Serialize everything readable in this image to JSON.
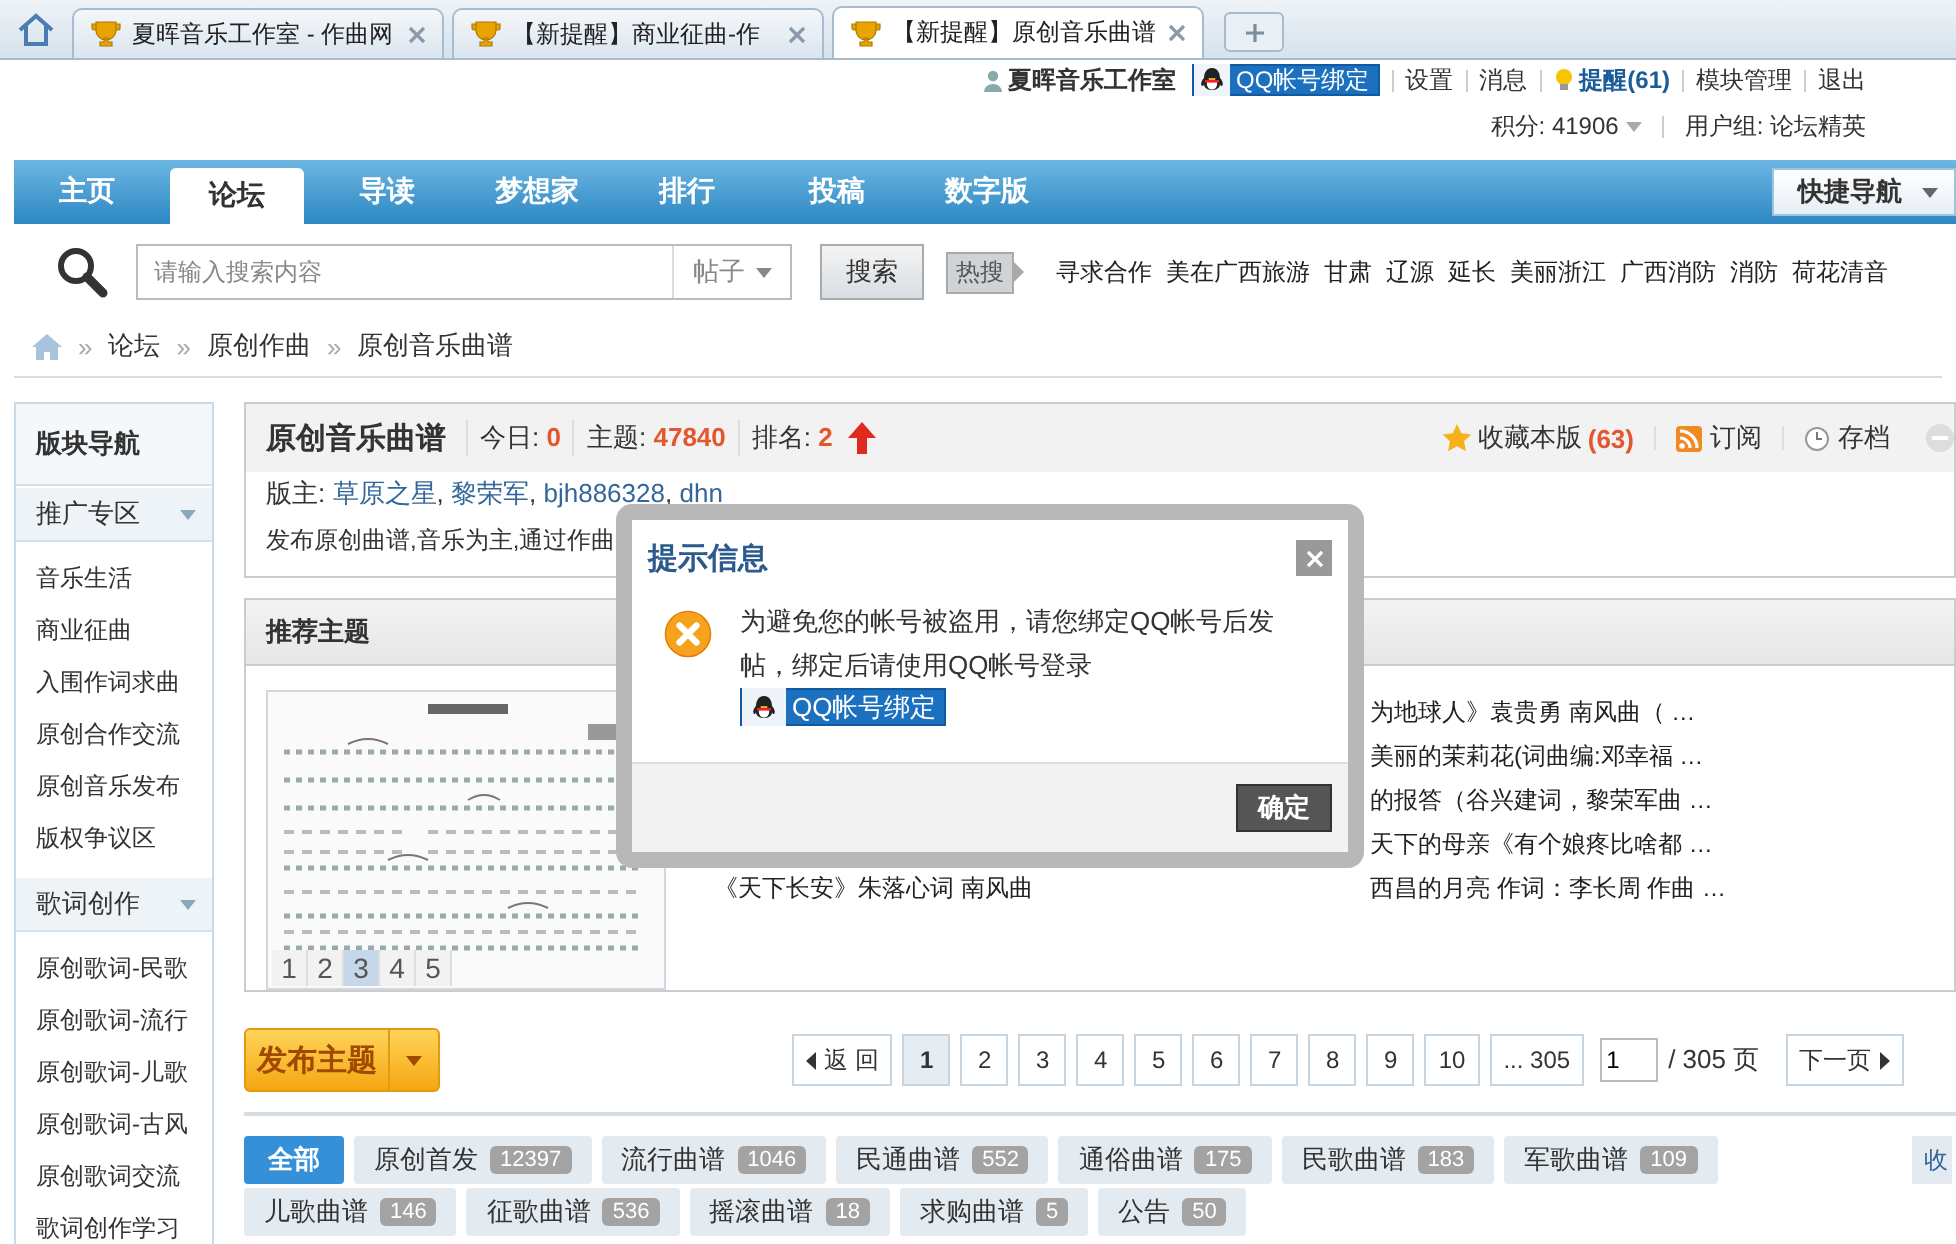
{
  "browser_tabs": [
    {
      "title": "夏晖音乐工作室 - 作曲网",
      "selected": false
    },
    {
      "title": "【新提醒】商业征曲-作",
      "selected": false
    },
    {
      "title": "【新提醒】原创音乐曲谱",
      "selected": true
    }
  ],
  "user_bar": {
    "username": "夏晖音乐工作室",
    "qq_bind": "QQ帐号绑定",
    "links": [
      {
        "label": "设置",
        "kind": "plain"
      },
      {
        "label": "消息",
        "kind": "plain"
      },
      {
        "label": "提醒(61)",
        "kind": "alert"
      },
      {
        "label": "模块管理",
        "kind": "plain"
      },
      {
        "label": "退出",
        "kind": "plain"
      }
    ],
    "credits": "积分: 41906",
    "usergroup": "用户组: 论坛精英"
  },
  "nav": {
    "items": [
      {
        "label": "主页",
        "selected": false
      },
      {
        "label": "论坛",
        "selected": true
      },
      {
        "label": "导读",
        "selected": false
      },
      {
        "label": "梦想家",
        "selected": false
      },
      {
        "label": "排行",
        "selected": false
      },
      {
        "label": "投稿",
        "selected": false
      },
      {
        "label": "数字版",
        "selected": false
      }
    ],
    "quick_nav": "快捷导航"
  },
  "search": {
    "placeholder": "请输入搜索内容",
    "scope": "帖子",
    "button": "搜索",
    "hot_label": "热搜",
    "hot_words": [
      "寻求合作",
      "美在广西旅游",
      "甘肃",
      "辽源",
      "延长",
      "美丽浙江",
      "广西消防",
      "消防",
      "荷花清音"
    ]
  },
  "breadcrumb": [
    {
      "sep": "»",
      "label": "论坛"
    },
    {
      "sep": "»",
      "label": "原创作曲"
    },
    {
      "sep": "»",
      "label": "原创音乐曲谱"
    }
  ],
  "sidebar": {
    "title": "版块导航",
    "groups": [
      {
        "name": "推广专区",
        "items": [
          "音乐生活",
          "商业征曲",
          "入围作词求曲",
          "原创合作交流",
          "原创音乐发布",
          "版权争议区"
        ]
      },
      {
        "name": "歌词创作",
        "items": [
          "原创歌词-民歌",
          "原创歌词-流行",
          "原创歌词-儿歌",
          "原创歌词-古风",
          "原创歌词交流",
          "歌词创作学习"
        ]
      }
    ]
  },
  "forum": {
    "title": "原创音乐曲谱",
    "stats": [
      {
        "label": "今日:",
        "value": "0"
      },
      {
        "label": "主题:",
        "value": "47840"
      },
      {
        "label": "排名:",
        "value": "2"
      }
    ],
    "favorite": "收藏本版",
    "favorite_count": "(63)",
    "subscribe": "订阅",
    "archive": "存档",
    "moderators_label": "版主:",
    "moderators": [
      {
        "name": "草原之星",
        "sep": ","
      },
      {
        "name": "黎荣军",
        "sep": ","
      },
      {
        "name": "bjh886328",
        "sep": ","
      },
      {
        "name": "dhn"
      }
    ],
    "description": "发布原创曲谱,音乐为主,通过作曲"
  },
  "recommended": {
    "title": "推荐主题",
    "slides": [
      {
        "label": "1",
        "selected": false
      },
      {
        "label": "2",
        "selected": false
      },
      {
        "label": "3",
        "selected": true
      },
      {
        "label": "4",
        "selected": false
      },
      {
        "label": "5",
        "selected": false
      }
    ],
    "threads_left": [
      "《天下长安》朱落心词 南风曲"
    ],
    "threads_right": [
      "为地球人》袁贵勇 南风曲（ …",
      "美丽的茉莉花(词曲编:邓幸福 …",
      "的报答（谷兴建词，黎荣军曲 …",
      "天下的母亲《有个娘疼比啥都 …",
      "西昌的月亮 作词：李长周 作曲 …"
    ]
  },
  "post_button": "发布主题",
  "pagination": {
    "prev": "返 回",
    "pages": [
      {
        "label": "1",
        "selected": true
      },
      {
        "label": "2",
        "selected": false
      },
      {
        "label": "3",
        "selected": false
      },
      {
        "label": "4",
        "selected": false
      },
      {
        "label": "5",
        "selected": false
      },
      {
        "label": "6",
        "selected": false
      },
      {
        "label": "7",
        "selected": false
      },
      {
        "label": "8",
        "selected": false
      },
      {
        "label": "9",
        "selected": false
      },
      {
        "label": "10",
        "selected": false
      },
      {
        "label": "... 305",
        "selected": false
      }
    ],
    "page_input": "1",
    "total": "/ 305 页",
    "next": "下一页"
  },
  "type_filters": [
    {
      "label": "全部",
      "selected": true
    },
    {
      "label": "原创首发",
      "count": "12397",
      "selected": false
    },
    {
      "label": "流行曲谱",
      "count": "1046",
      "selected": false
    },
    {
      "label": "民通曲谱",
      "count": "552",
      "selected": false
    },
    {
      "label": "通俗曲谱",
      "count": "175",
      "selected": false
    },
    {
      "label": "民歌曲谱",
      "count": "183",
      "selected": false
    },
    {
      "label": "军歌曲谱",
      "count": "109",
      "selected": false
    },
    {
      "label": "儿歌曲谱",
      "count": "146",
      "selected": false
    },
    {
      "label": "征歌曲谱",
      "count": "536",
      "selected": false
    },
    {
      "label": "摇滚曲谱",
      "count": "18",
      "selected": false
    },
    {
      "label": "求购曲谱",
      "count": "5",
      "selected": false
    },
    {
      "label": "公告",
      "count": "50",
      "selected": false
    }
  ],
  "collapse_link": "收",
  "dialog": {
    "title": "提示信息",
    "message": "为避免您的帐号被盗用，请您绑定QQ帐号后发帖，绑定后请使用QQ帐号登录",
    "bind_button": "QQ帐号绑定",
    "confirm": "确定"
  }
}
